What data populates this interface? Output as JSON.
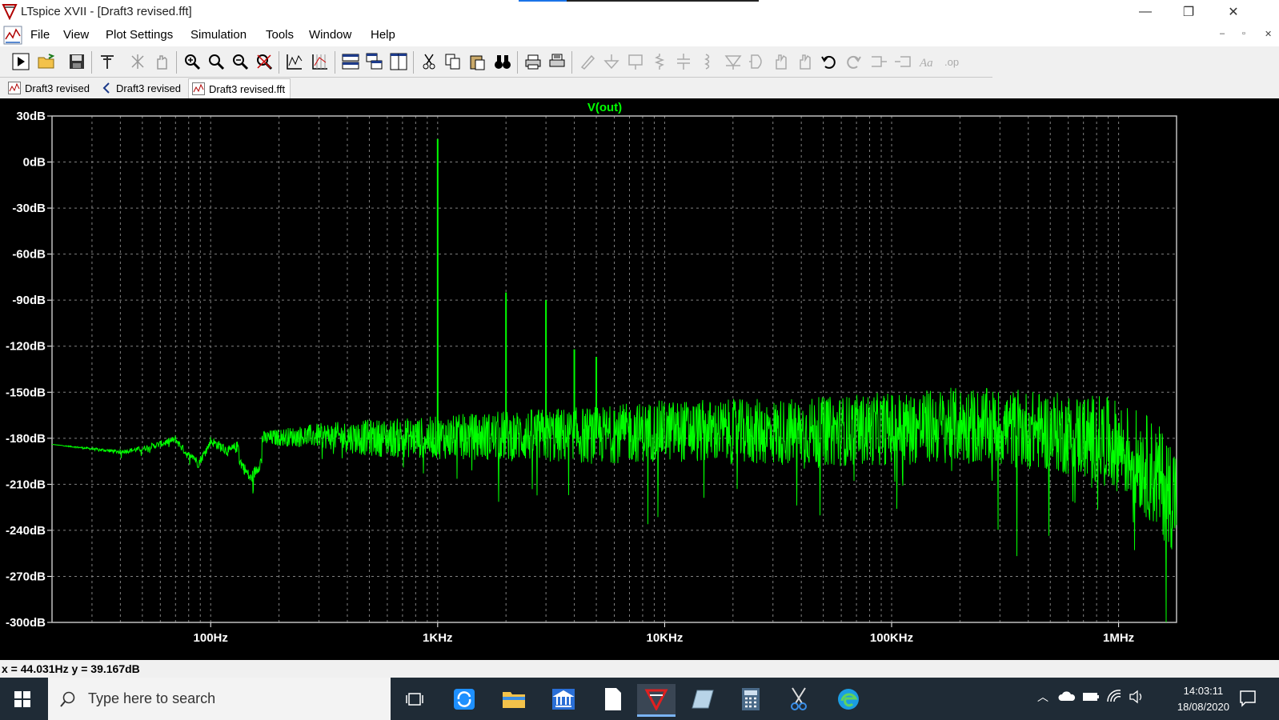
{
  "window": {
    "title": "LTspice XVII - [Draft3 revised.fft]",
    "minimize": "—",
    "restore": "❐",
    "close": "✕"
  },
  "menu": [
    "File",
    "View",
    "Plot Settings",
    "Simulation",
    "Tools",
    "Window",
    "Help"
  ],
  "mdi_controls": [
    "–",
    "▫",
    "✕"
  ],
  "tabs": [
    {
      "label": "Draft3 revised",
      "icon": "waveform-icon",
      "active": false
    },
    {
      "label": "Draft3 revised",
      "icon": "schematic-icon",
      "active": false
    },
    {
      "label": "Draft3 revised.fft",
      "icon": "waveform-icon",
      "active": true
    }
  ],
  "status": {
    "coords": "x = 44.031Hz    y = 39.167dB"
  },
  "taskbar": {
    "search_placeholder": "Type here to search",
    "time": "14:03:11",
    "date": "18/08/2020"
  },
  "colors": {
    "trace": "#00ff00",
    "plot_bg": "#000000",
    "grid": "#808080",
    "axis_text": "#ffffff",
    "trace_title": "#00ff00"
  },
  "chart_data": {
    "type": "line",
    "title": "V(out)",
    "xscale": "log",
    "xlim": [
      20,
      1800000
    ],
    "ylim": [
      -300,
      30
    ],
    "grid": true,
    "xticks": [
      {
        "value": 100,
        "label": "100Hz"
      },
      {
        "value": 1000,
        "label": "1KHz"
      },
      {
        "value": 10000,
        "label": "10KHz"
      },
      {
        "value": 100000,
        "label": "100KHz"
      },
      {
        "value": 1000000,
        "label": "1MHz"
      }
    ],
    "yticks": [
      {
        "value": 30,
        "label": "30dB"
      },
      {
        "value": 0,
        "label": "0dB"
      },
      {
        "value": -30,
        "label": "-30dB"
      },
      {
        "value": -60,
        "label": "-60dB"
      },
      {
        "value": -90,
        "label": "-90dB"
      },
      {
        "value": -120,
        "label": "-120dB"
      },
      {
        "value": -150,
        "label": "-150dB"
      },
      {
        "value": -180,
        "label": "-180dB"
      },
      {
        "value": -210,
        "label": "-210dB"
      },
      {
        "value": -240,
        "label": "-240dB"
      },
      {
        "value": -270,
        "label": "-270dB"
      },
      {
        "value": -300,
        "label": "-300dB"
      }
    ],
    "series": [
      {
        "noise_floor": [
          [
            20,
            -184
          ],
          [
            30,
            -187
          ],
          [
            40,
            -189
          ],
          [
            50,
            -187
          ],
          [
            60,
            -184
          ],
          [
            70,
            -181
          ],
          [
            80,
            -192
          ],
          [
            100,
            -182
          ],
          [
            120,
            -189
          ],
          [
            150,
            -181
          ],
          [
            200,
            -180
          ],
          [
            300,
            -179
          ],
          [
            500,
            -181
          ],
          [
            700,
            -181
          ],
          [
            1000,
            -181
          ],
          [
            2000,
            -180
          ],
          [
            5000,
            -180
          ],
          [
            10000,
            -177
          ],
          [
            20000,
            -178
          ],
          [
            50000,
            -178
          ],
          [
            100000,
            -176
          ],
          [
            200000,
            -174
          ],
          [
            500000,
            -178
          ],
          [
            800000,
            -183
          ],
          [
            1000000,
            -188
          ],
          [
            1300000,
            -200
          ],
          [
            1600000,
            -215
          ],
          [
            1800000,
            -222
          ]
        ],
        "noise_amplitude": [
          [
            20,
            0
          ],
          [
            150,
            4
          ],
          [
            300,
            8
          ],
          [
            500,
            12
          ],
          [
            1000,
            14
          ],
          [
            3000,
            18
          ],
          [
            10000,
            20
          ],
          [
            100000,
            24
          ],
          [
            500000,
            26
          ],
          [
            1000000,
            30
          ],
          [
            1800000,
            38
          ]
        ],
        "dips": [
          {
            "x": 88,
            "y": -197
          },
          {
            "x": 150,
            "y": -207
          }
        ],
        "spikes": [
          {
            "x": 1000,
            "y": 15
          },
          {
            "x": 2000,
            "y": -85
          },
          {
            "x": 3000,
            "y": -90
          },
          {
            "x": 4000,
            "y": -122
          },
          {
            "x": 5000,
            "y": -127
          },
          {
            "x": 6000,
            "y": -162
          },
          {
            "x": 7000,
            "y": -163
          },
          {
            "x": 8000,
            "y": -168
          }
        ]
      }
    ]
  }
}
